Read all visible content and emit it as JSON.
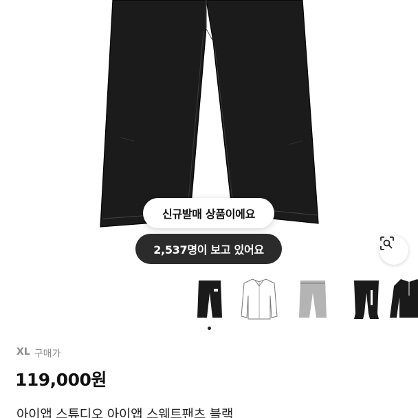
{
  "product": {
    "badge_new": "신규발매 상품이에요",
    "viewers": "2,537명이 보고 있어요",
    "size": "XL",
    "price_type": "구매가",
    "price": "119,000원",
    "title": "아이앱 스튜디오 아이앱 스웨트팬츠 블랙"
  },
  "thumbnails": [
    {
      "name": "black-sweatpants",
      "color": "#1a1a1a"
    },
    {
      "name": "white-shirt",
      "color": "#ffffff"
    },
    {
      "name": "grey-sweatpants",
      "color": "#b4b4b4"
    },
    {
      "name": "black-jogger",
      "color": "#1a1a1a"
    },
    {
      "name": "black-halfzip",
      "color": "#1a1a1a"
    }
  ],
  "icons": {
    "lens": "lens-search-icon",
    "page_indicator": "page-dot"
  }
}
